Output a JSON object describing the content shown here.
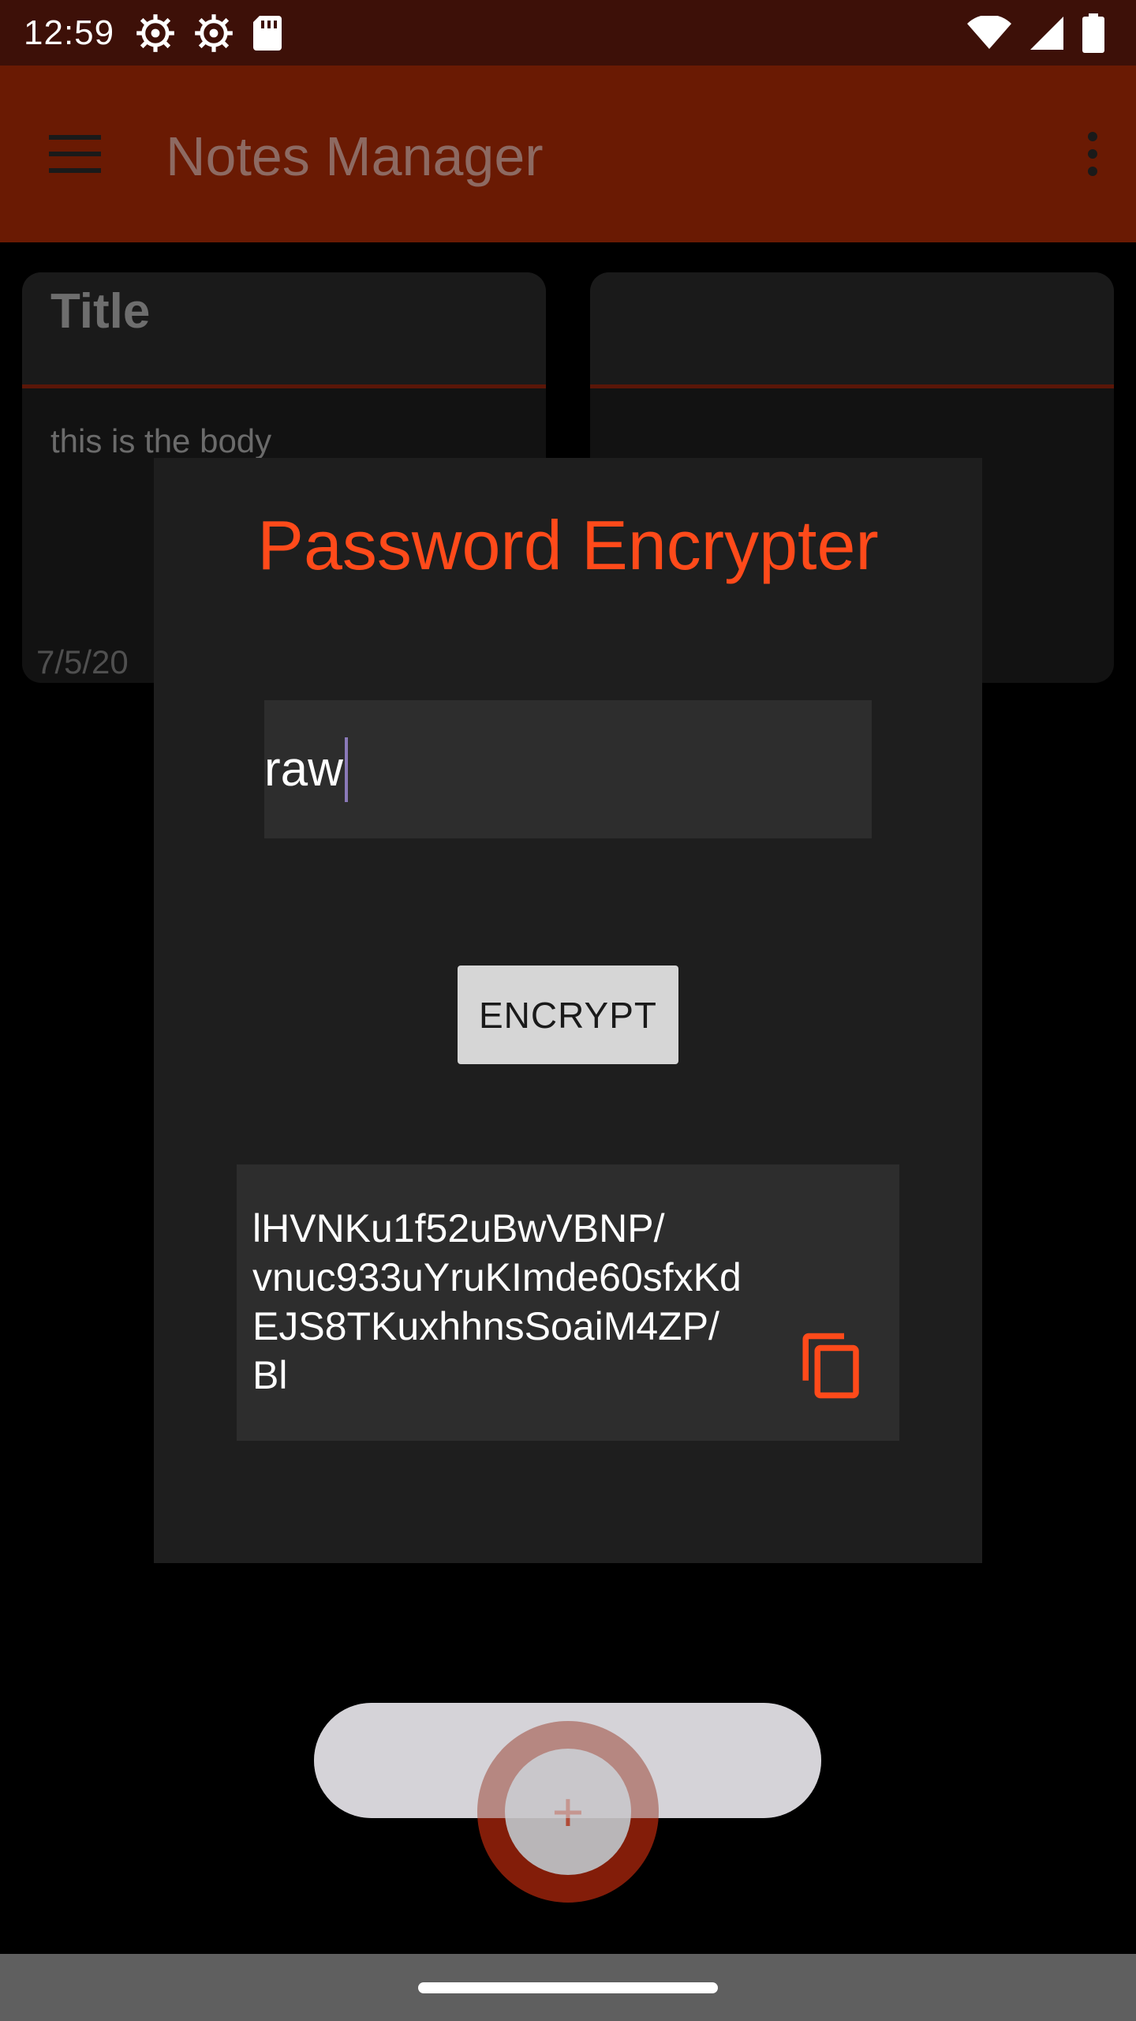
{
  "status_bar": {
    "time": "12:59",
    "left_icons": [
      "settings-gear-icon",
      "settings-gear-icon",
      "sd-card-icon"
    ],
    "right_icons": [
      "wifi-icon",
      "cellular-signal-icon",
      "battery-icon"
    ]
  },
  "app_bar": {
    "title": "Notes Manager",
    "menu_icon": "hamburger-menu-icon",
    "overflow_icon": "more-vert-icon"
  },
  "notes": [
    {
      "title": "Title",
      "body": "this is the body",
      "date": "7/5/20"
    },
    {
      "title": "",
      "body": "",
      "date": ""
    }
  ],
  "dialog": {
    "title": "Password Encrypter",
    "input_value": "raw",
    "encrypt_label": "ENCRYPT",
    "output_value": "lHVNKu1f52uBwVBNP/\nvnuc933uYruKImde60sfxKd\nEJS8TKuxhhnsSoaiM4ZP/\nBl",
    "copy_icon": "content-copy-icon"
  },
  "fab": {
    "label": "+"
  },
  "colors": {
    "status_bar": "#3d1008",
    "app_bar": "#6a1a03",
    "accent": "#ff4a1a",
    "dialog_bg": "#1e1e1e",
    "field_bg": "#2d2d2d",
    "button_bg": "#d6d6d6"
  }
}
